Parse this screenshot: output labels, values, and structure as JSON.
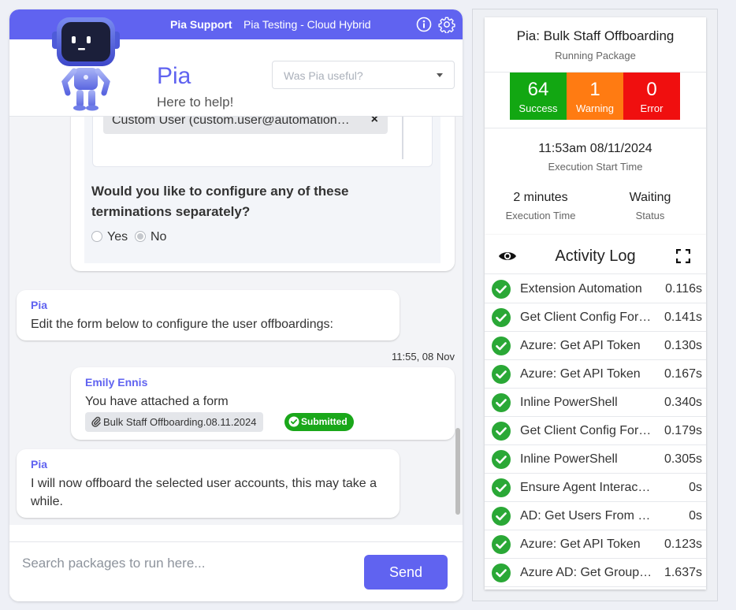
{
  "topbar": {
    "brand": "Pia Support",
    "instance": "Pia Testing - Cloud Hybrid",
    "info_icon": "info-icon",
    "settings_icon": "gear-icon"
  },
  "header": {
    "title": "Pia",
    "subtitle": "Here to help!",
    "feedback_placeholder": "Was Pia useful?",
    "avatar_icon": "robot-mascot"
  },
  "form": {
    "selected_user": "Custom User (custom.user@automation…",
    "remove_glyph": "×",
    "question": "Would you like to configure any of these terminations separately?",
    "options": [
      "Yes",
      "No"
    ],
    "selected_option": "No"
  },
  "messages": [
    {
      "sender": "Pia",
      "text": "Edit the form below to configure the user offboardings:"
    },
    {
      "timestamp": "11:55, 08 Nov",
      "sender": "Emily Ennis",
      "text": "You have attached a form",
      "attachment": "Bulk Staff Offboarding.08.11.2024",
      "badge": "Submitted"
    },
    {
      "sender": "Pia",
      "text": "I will now offboard the selected user accounts, this may take a while."
    }
  ],
  "input": {
    "placeholder": "Search packages to run here...",
    "send_label": "Send"
  },
  "status": {
    "title": "Pia: Bulk Staff Offboarding",
    "subtitle": "Running Package",
    "success": {
      "count": "64",
      "label": "Success",
      "color": "#12a712"
    },
    "warning": {
      "count": "1",
      "label": "Warning",
      "color": "#ff7b12"
    },
    "error": {
      "count": "0",
      "label": "Error",
      "color": "#f00f0f"
    },
    "start_time": "11:53am 08/11/2024",
    "start_label": "Execution Start Time",
    "exec_time": "2 minutes",
    "exec_label": "Execution Time",
    "state": "Waiting",
    "state_label": "Status"
  },
  "log": {
    "title": "Activity Log",
    "rows": [
      {
        "name": "Extension Automation",
        "duration": "0.116s"
      },
      {
        "name": "Get Client Config For…",
        "duration": "0.141s"
      },
      {
        "name": "Azure: Get API Token",
        "duration": "0.130s"
      },
      {
        "name": "Azure: Get API Token",
        "duration": "0.167s"
      },
      {
        "name": "Inline PowerShell",
        "duration": "0.340s"
      },
      {
        "name": "Get Client Config For…",
        "duration": "0.179s"
      },
      {
        "name": "Inline PowerShell",
        "duration": "0.305s"
      },
      {
        "name": "Ensure Agent Interac…",
        "duration": "0s"
      },
      {
        "name": "AD: Get Users From …",
        "duration": "0s"
      },
      {
        "name": "Azure: Get API Token",
        "duration": "0.123s"
      },
      {
        "name": "Azure AD: Get Group…",
        "duration": "1.637s"
      }
    ]
  },
  "colors": {
    "accent": "#6063f0",
    "success": "#12a712",
    "check": "#2aa836"
  }
}
